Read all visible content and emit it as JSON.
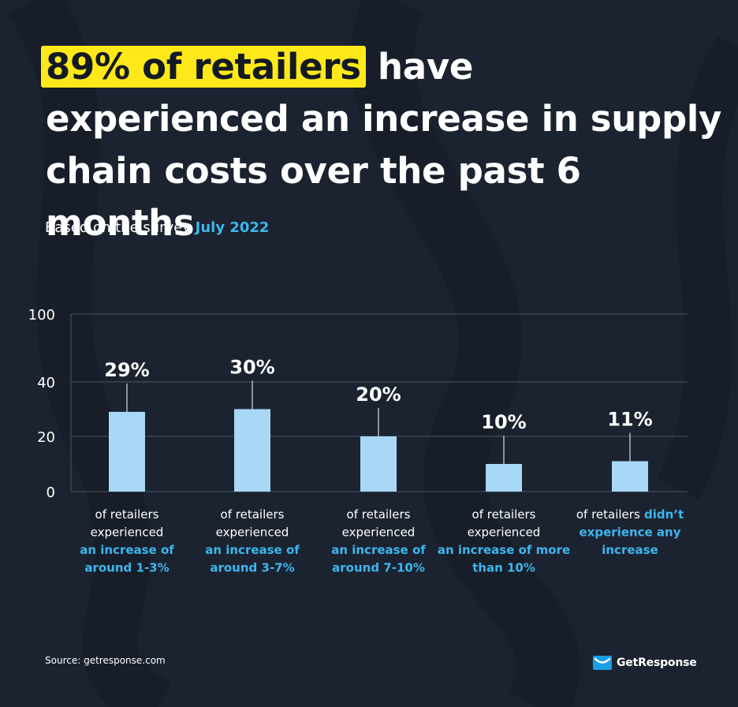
{
  "headline": {
    "highlight": "89% of retailers",
    "rest": " have experienced an increase in supply chain costs over the past 6 months"
  },
  "subtitle": {
    "prefix": "Based on the survey ",
    "accent": "July 2022"
  },
  "chart_data": {
    "type": "bar",
    "y_ticks": [
      "0",
      "20",
      "40",
      "100"
    ],
    "categories": [
      {
        "line1": "of retailers",
        "line2": "experienced",
        "accent1": "an increase of",
        "accent2": "around 1-3%"
      },
      {
        "line1": "of retailers",
        "line2": "experienced",
        "accent1": "an increase of",
        "accent2": "around 3-7%"
      },
      {
        "line1": "of retailers",
        "line2": "experienced",
        "accent1": "an increase of",
        "accent2": "around 7-10%"
      },
      {
        "line1": "of retailers",
        "line2": "experienced",
        "accent1": "an increase of more",
        "accent2": "than 10%"
      },
      {
        "line1": "of retailers",
        "line1_accent": " didn’t",
        "accent1": "experience any",
        "accent2": "increase"
      }
    ],
    "values": [
      29,
      30,
      20,
      10,
      11
    ],
    "value_labels": [
      "29%",
      "30%",
      "20%",
      "10%",
      "11%"
    ],
    "grid": true,
    "bar_color": "#a8d8f6",
    "accent_color": "#3db6ee"
  },
  "footer": {
    "source": "Source: getresponse.com",
    "brand": "GetResponse"
  },
  "colors": {
    "background": "#1b2330",
    "highlight": "#ffe81a",
    "accent": "#3db6ee"
  }
}
